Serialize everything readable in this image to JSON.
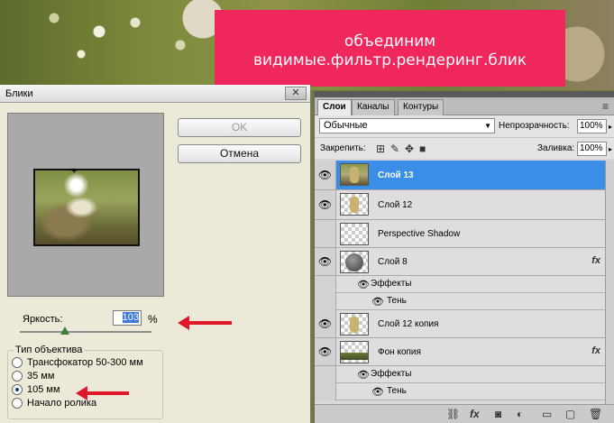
{
  "banner": {
    "line1": "объединим",
    "line2": "видимые.фильтр.рендеринг.блик"
  },
  "dialog": {
    "title": "Блики",
    "ok_label": "OK",
    "cancel_label": "Отмена",
    "brightness_label": "Яркость:",
    "brightness_value": "103",
    "percent": "%",
    "lens_group_label": "Тип объектива",
    "lens_options": [
      {
        "label": "Трансфокатор 50-300 мм",
        "selected": false
      },
      {
        "label": "35 мм",
        "selected": false
      },
      {
        "label": "105 мм",
        "selected": true
      },
      {
        "label": "Начало ролика",
        "selected": false
      }
    ]
  },
  "panel": {
    "tabs": [
      {
        "label": "Слои"
      },
      {
        "label": "Каналы"
      },
      {
        "label": "Контуры"
      }
    ],
    "blend_mode": "Обычные",
    "opacity_label": "Непрозрачность:",
    "opacity_value": "100%",
    "lock_label": "Закрепить:",
    "fill_label": "Заливка:",
    "fill_value": "100%",
    "layers": [
      {
        "name": "Слой 13",
        "selected": true
      },
      {
        "name": "Слой 12"
      },
      {
        "name": "Perspective Shadow"
      },
      {
        "name": "Слой 8",
        "fx": true
      },
      {
        "name": "Слой 12 копия"
      },
      {
        "name": "Фон копия",
        "fx": true
      }
    ],
    "effects_label": "Эффекты",
    "shadow_label": "Тень",
    "fx_symbol": "fx"
  },
  "colors": {
    "banner": "#f0275c",
    "selection": "#3b8ee6",
    "arrow": "#e0182b"
  }
}
